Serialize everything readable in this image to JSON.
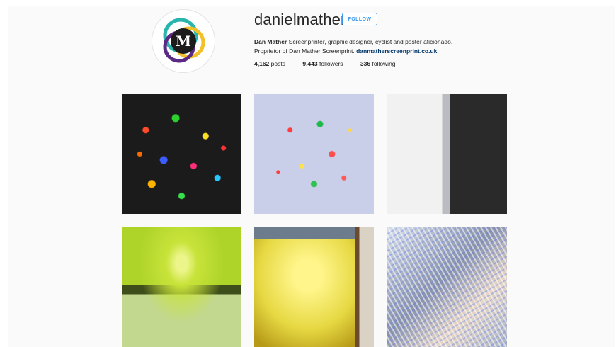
{
  "profile": {
    "username": "danielmather",
    "follow_label": "FOLLOW",
    "avatar_letter": "M",
    "bio": {
      "name": "Dan Mather",
      "line1": " Screenprinter, graphic designer, cyclist and poster aficionado.",
      "line2": "Proprietor of Dan Mather Screenprint. ",
      "link": "danmatherscreenprint.co.uk"
    },
    "stats": {
      "posts_count": "4,162",
      "posts_label": " posts",
      "followers_count": "9,443",
      "followers_label": " followers",
      "following_count": "336",
      "following_label": " following"
    }
  },
  "colors": {
    "follow_blue": "#3897f0",
    "link_navy": "#003569",
    "avatar_ring_teal": "#28b5ad",
    "avatar_ring_purple": "#5b2a86",
    "avatar_ring_yellow": "#f2c029"
  },
  "posts": [
    {
      "name": "post-confetti-dark"
    },
    {
      "name": "post-confetti-light"
    },
    {
      "name": "post-white-black-panel"
    },
    {
      "name": "post-green-screen"
    },
    {
      "name": "post-yellow-frame"
    },
    {
      "name": "post-holographic"
    }
  ]
}
